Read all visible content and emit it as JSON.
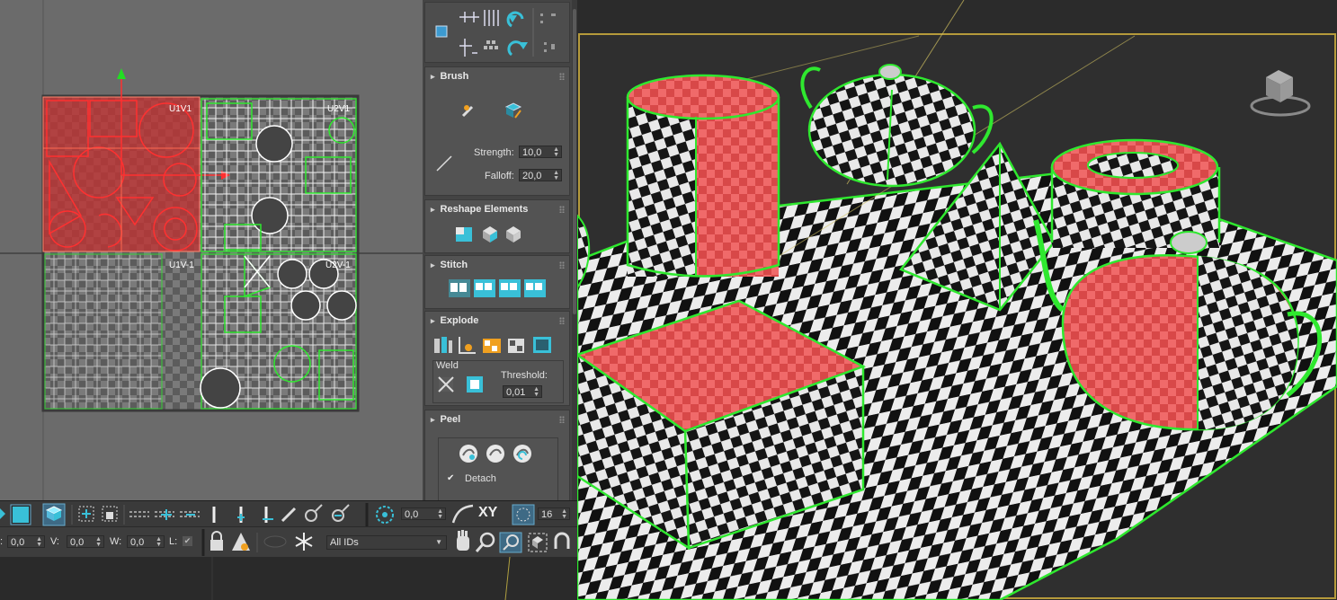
{
  "uv_editor": {
    "tile_labels": [
      "U1V1",
      "U2V1",
      "U1V-1",
      "U2V-1"
    ]
  },
  "rollouts": {
    "brush": {
      "title": "Brush",
      "strength_label": "Strength:",
      "strength_value": "10,0",
      "falloff_label": "Falloff:",
      "falloff_value": "20,0"
    },
    "reshape": {
      "title": "Reshape Elements"
    },
    "stitch": {
      "title": "Stitch"
    },
    "explode": {
      "title": "Explode",
      "weld_label": "Weld",
      "threshold_label": "Threshold:",
      "threshold_value": "0,01"
    },
    "peel": {
      "title": "Peel",
      "detach_label": "Detach",
      "detach_checked": true
    }
  },
  "toolbar": {
    "angle_value": "0,0",
    "xy_label": "XY",
    "grid_value": "16",
    "u_value": "0,0",
    "v_label": "V:",
    "v_value": "0,0",
    "w_label": "W:",
    "w_value": "0,0",
    "l_label": "L:",
    "id_filter": "All IDs"
  },
  "colors": {
    "selection_red": "#e83434",
    "wire_green": "#2fe82f",
    "accent_teal": "#39c0d8",
    "panel_bg": "#444444",
    "uv_bg": "#6b6b6b"
  },
  "viewport": {
    "objects": [
      "cylinder",
      "teapot",
      "pyramid",
      "tube",
      "teapot",
      "box",
      "plane"
    ]
  }
}
